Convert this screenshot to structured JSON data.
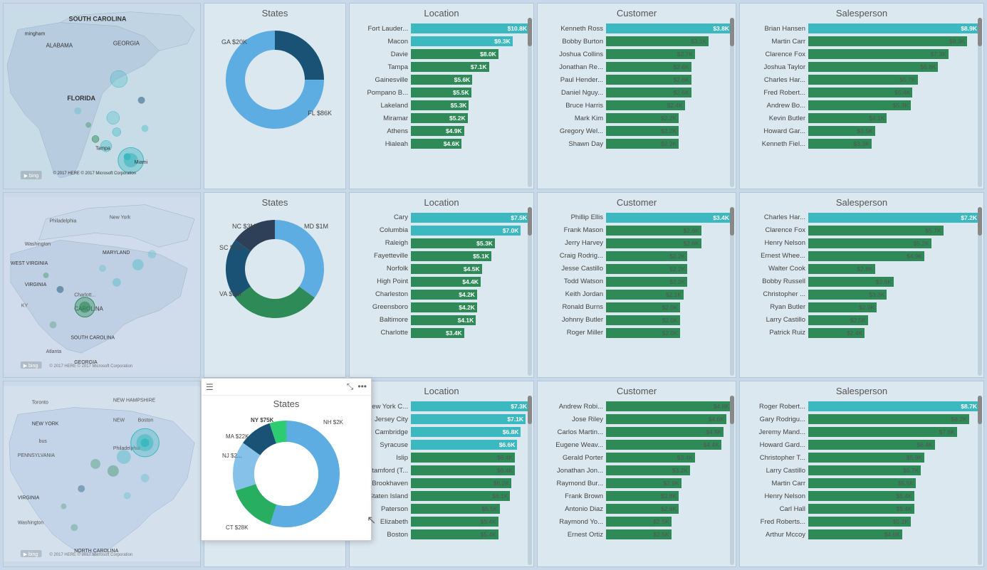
{
  "rows": [
    {
      "id": "row1",
      "map_region": "South Carolina / Florida",
      "states": {
        "title": "States",
        "segments": [
          {
            "label": "GA $20K",
            "color": "#1a5276",
            "pct": 25,
            "pos": "top-left"
          },
          {
            "label": "FL $86K",
            "color": "#5dade2",
            "pct": 75,
            "pos": "bottom-right"
          }
        ]
      },
      "location": {
        "title": "Location",
        "bars": [
          {
            "label": "Fort Lauder...",
            "value": "$10.8K",
            "pct": 100,
            "highlight": true
          },
          {
            "label": "Macon",
            "value": "$9.3K",
            "pct": 86,
            "highlight": true
          },
          {
            "label": "Davie",
            "value": "$8.0K",
            "pct": 74,
            "highlight": false
          },
          {
            "label": "Tampa",
            "value": "$7.1K",
            "pct": 66,
            "highlight": false
          },
          {
            "label": "Gainesville",
            "value": "$5.6K",
            "pct": 52,
            "highlight": false
          },
          {
            "label": "Pompano B...",
            "value": "$5.5K",
            "pct": 51,
            "highlight": false
          },
          {
            "label": "Lakeland",
            "value": "$5.3K",
            "pct": 49,
            "highlight": false
          },
          {
            "label": "Miramar",
            "value": "$5.2K",
            "pct": 48,
            "highlight": false
          },
          {
            "label": "Athens",
            "value": "$4.9K",
            "pct": 45,
            "highlight": false
          },
          {
            "label": "Hialeah",
            "value": "$4.6K",
            "pct": 43,
            "highlight": false
          }
        ]
      },
      "customer": {
        "title": "Customer",
        "bars": [
          {
            "label": "Kenneth Ross",
            "value": "$3.8K",
            "pct": 100,
            "highlight": true
          },
          {
            "label": "Bobby Burton",
            "value": "$3.1K",
            "pct": 82
          },
          {
            "label": "Joshua Collins",
            "value": "$2.7K",
            "pct": 71
          },
          {
            "label": "Jonathan Re...",
            "value": "$2.6K",
            "pct": 68
          },
          {
            "label": "Paul Hender...",
            "value": "$2.6K",
            "pct": 68
          },
          {
            "label": "Daniel Nguy...",
            "value": "$2.6K",
            "pct": 68
          },
          {
            "label": "Bruce Harris",
            "value": "$2.4K",
            "pct": 63
          },
          {
            "label": "Mark Kim",
            "value": "$2.2K",
            "pct": 58
          },
          {
            "label": "Gregory Wel...",
            "value": "$2.2K",
            "pct": 58
          },
          {
            "label": "Shawn Day",
            "value": "$2.2K",
            "pct": 58
          }
        ]
      },
      "salesperson": {
        "title": "Salesperson",
        "bars": [
          {
            "label": "Brian Hansen",
            "value": "$8.9K",
            "pct": 100,
            "highlight": true
          },
          {
            "label": "Martin Carr",
            "value": "$8.3K",
            "pct": 93
          },
          {
            "label": "Clarence Fox",
            "value": "$7.3K",
            "pct": 82
          },
          {
            "label": "Joshua Taylor",
            "value": "$6.8K",
            "pct": 76
          },
          {
            "label": "Charles Har...",
            "value": "$5.7K",
            "pct": 64
          },
          {
            "label": "Fred Robert...",
            "value": "$5.4K",
            "pct": 61
          },
          {
            "label": "Andrew Bo...",
            "value": "$5.3K",
            "pct": 60
          },
          {
            "label": "Kevin Butler",
            "value": "$4.1K",
            "pct": 46
          },
          {
            "label": "Howard Gar...",
            "value": "$3.5K",
            "pct": 39
          },
          {
            "label": "Kenneth Fiel...",
            "value": "$3.3K",
            "pct": 37
          }
        ]
      }
    },
    {
      "id": "row2",
      "map_region": "Mid-Atlantic",
      "states": {
        "title": "States",
        "segments": [
          {
            "label": "MD $1M",
            "color": "#1a5276",
            "pct": 20
          },
          {
            "label": "SC $1M",
            "color": "#2e4057",
            "pct": 15
          },
          {
            "label": "NC $3M",
            "color": "#5dade2",
            "pct": 35
          },
          {
            "label": "VA $3M",
            "color": "#2e8b57",
            "pct": 30
          }
        ]
      },
      "location": {
        "title": "Location",
        "bars": [
          {
            "label": "Cary",
            "value": "$7.5K",
            "pct": 100,
            "highlight": true
          },
          {
            "label": "Columbia",
            "value": "$7.0K",
            "pct": 93,
            "highlight": true
          },
          {
            "label": "Raleigh",
            "value": "$5.3K",
            "pct": 71
          },
          {
            "label": "Fayetteville",
            "value": "$5.1K",
            "pct": 68
          },
          {
            "label": "Norfolk",
            "value": "$4.5K",
            "pct": 60
          },
          {
            "label": "High Point",
            "value": "$4.4K",
            "pct": 59
          },
          {
            "label": "Charleston",
            "value": "$4.2K",
            "pct": 56
          },
          {
            "label": "Greensboro",
            "value": "$4.2K",
            "pct": 56
          },
          {
            "label": "Baltimore",
            "value": "$4.1K",
            "pct": 55
          },
          {
            "label": "Charlotte",
            "value": "$3.4K",
            "pct": 45
          }
        ]
      },
      "customer": {
        "title": "Customer",
        "bars": [
          {
            "label": "Phillip Ellis",
            "value": "$3.4K",
            "pct": 100,
            "highlight": true
          },
          {
            "label": "Frank Mason",
            "value": "$2.6K",
            "pct": 76
          },
          {
            "label": "Jerry Harvey",
            "value": "$2.6K",
            "pct": 76
          },
          {
            "label": "Craig Rodrig...",
            "value": "$2.2K",
            "pct": 65
          },
          {
            "label": "Jesse Castillo",
            "value": "$2.2K",
            "pct": 65
          },
          {
            "label": "Todd Watson",
            "value": "$2.2K",
            "pct": 65
          },
          {
            "label": "Keith Jordan",
            "value": "$2.1K",
            "pct": 62
          },
          {
            "label": "Ronald Burns",
            "value": "$2.0K",
            "pct": 59
          },
          {
            "label": "Johnny Butler",
            "value": "$2.0K",
            "pct": 59
          },
          {
            "label": "Roger Miller",
            "value": "$2.0K",
            "pct": 59
          }
        ]
      },
      "salesperson": {
        "title": "Salesperson",
        "bars": [
          {
            "label": "Charles Har...",
            "value": "$7.2K",
            "pct": 100,
            "highlight": true
          },
          {
            "label": "Clarence Fox",
            "value": "$5.7K",
            "pct": 79
          },
          {
            "label": "Henry Nelson",
            "value": "$5.2K",
            "pct": 72
          },
          {
            "label": "Ernest Whee...",
            "value": "$4.9K",
            "pct": 68
          },
          {
            "label": "Walter Cook",
            "value": "$2.8K",
            "pct": 39
          },
          {
            "label": "Bobby Russell",
            "value": "$3.6K",
            "pct": 50
          },
          {
            "label": "Christopher ...",
            "value": "$3.3K",
            "pct": 46
          },
          {
            "label": "Ryan Butler",
            "value": "$2.9K",
            "pct": 40
          },
          {
            "label": "Larry Castillo",
            "value": "$2.5K",
            "pct": 35
          },
          {
            "label": "Patrick Ruiz",
            "value": "$2.4K",
            "pct": 33
          }
        ]
      }
    },
    {
      "id": "row3",
      "map_region": "Northeast",
      "states": {
        "title": "States",
        "segments": [
          {
            "label": "NH $2K",
            "color": "#2ecc71",
            "pct": 5
          },
          {
            "label": "MA $22K",
            "color": "#27ae60",
            "pct": 15
          },
          {
            "label": "NJ $2...",
            "color": "#1a5276",
            "pct": 10
          },
          {
            "label": "NY $75K",
            "color": "#5dade2",
            "pct": 55
          },
          {
            "label": "CT $28K",
            "color": "#85c1e9",
            "pct": 15
          }
        ]
      },
      "location": {
        "title": "Location",
        "bars": [
          {
            "label": "New York C...",
            "value": "$7.3K",
            "pct": 100,
            "highlight": true
          },
          {
            "label": "Jersey City",
            "value": "$7.1K",
            "pct": 97,
            "highlight": true
          },
          {
            "label": "Cambridge",
            "value": "$6.8K",
            "pct": 93,
            "highlight": true
          },
          {
            "label": "Syracuse",
            "value": "$6.6K",
            "pct": 90,
            "highlight": true
          },
          {
            "label": "Islip",
            "value": "$6.4K",
            "pct": 88
          },
          {
            "label": "Stamford (T...",
            "value": "$6.4K",
            "pct": 88
          },
          {
            "label": "Brookhaven",
            "value": "$6.2K",
            "pct": 85
          },
          {
            "label": "Staten Island",
            "value": "$6.1K",
            "pct": 84
          },
          {
            "label": "Paterson",
            "value": "$5.5K",
            "pct": 75
          },
          {
            "label": "Elizabeth",
            "value": "$5.4K",
            "pct": 74
          },
          {
            "label": "Boston",
            "value": "$5.4K",
            "pct": 74
          }
        ]
      },
      "customer": {
        "title": "Customer",
        "bars": [
          {
            "label": "Andrew Robi...",
            "value": "$4.8K",
            "pct": 100
          },
          {
            "label": "Jose Riley",
            "value": "$4.6K",
            "pct": 96
          },
          {
            "label": "Carlos Martin...",
            "value": "$4.5K",
            "pct": 94
          },
          {
            "label": "Eugene Weav...",
            "value": "$4.4K",
            "pct": 92
          },
          {
            "label": "Gerald Porter",
            "value": "$3.4K",
            "pct": 71
          },
          {
            "label": "Jonathan Jon...",
            "value": "$3.2K",
            "pct": 67
          },
          {
            "label": "Raymond Bur...",
            "value": "$2.9K",
            "pct": 60
          },
          {
            "label": "Frank Brown",
            "value": "$2.8K",
            "pct": 58
          },
          {
            "label": "Antonio Diaz",
            "value": "$2.8K",
            "pct": 58
          },
          {
            "label": "Raymond Yo...",
            "value": "$2.5K",
            "pct": 52
          },
          {
            "label": "Ernest Ortiz",
            "value": "$2.5K",
            "pct": 52
          }
        ]
      },
      "salesperson": {
        "title": "Salesperson",
        "bars": [
          {
            "label": "Roger Robert...",
            "value": "$8.7K",
            "pct": 100,
            "highlight": true
          },
          {
            "label": "Gary Rodrigu...",
            "value": "$8.2K",
            "pct": 94
          },
          {
            "label": "Jeremy Mand...",
            "value": "$7.6K",
            "pct": 87
          },
          {
            "label": "Howard Gard...",
            "value": "$6.4K",
            "pct": 74
          },
          {
            "label": "Christopher T...",
            "value": "$5.9K",
            "pct": 68
          },
          {
            "label": "Larry Castillo",
            "value": "$5.7K",
            "pct": 66
          },
          {
            "label": "Martin Carr",
            "value": "$5.5K",
            "pct": 63
          },
          {
            "label": "Henry Nelson",
            "value": "$5.4K",
            "pct": 62
          },
          {
            "label": "Carl Hall",
            "value": "$5.4K",
            "pct": 62
          },
          {
            "label": "Fred Roberts...",
            "value": "$5.2K",
            "pct": 60
          },
          {
            "label": "Arthur Mccoy",
            "value": "$4.8K",
            "pct": 55
          }
        ]
      }
    }
  ]
}
